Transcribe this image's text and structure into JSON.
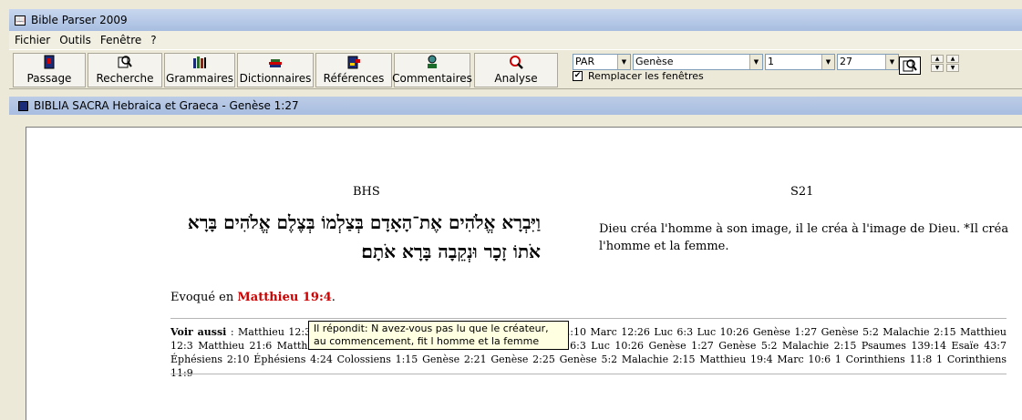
{
  "window": {
    "title": "Bible Parser 2009"
  },
  "menu": [
    "Fichier",
    "Outils",
    "Fenêtre",
    "?"
  ],
  "toolbar": {
    "buttons": [
      {
        "label": "Passage",
        "icon": "bible-book-icon"
      },
      {
        "label": "Recherche",
        "icon": "search-magnifier-icon"
      },
      {
        "label": "Grammaires",
        "icon": "grammar-books-icon"
      },
      {
        "label": "Dictionnaires",
        "icon": "dictionary-books-icon"
      },
      {
        "label": "Références",
        "icon": "references-book-icon"
      },
      {
        "label": "Commentaires",
        "icon": "commentary-person-icon"
      },
      {
        "label": "Analyse",
        "icon": "analysis-magnifier-icon"
      }
    ],
    "version_select": "PAR",
    "book_select": "Genèse",
    "chapter_select": "1",
    "verse_select": "27",
    "replace_windows_label": "Remplacer les fenêtres",
    "replace_windows_checked": true
  },
  "document": {
    "title": "BIBLIA SACRA Hebraica et Graeca - Genèse 1:27",
    "bhs_header": "BHS",
    "s21_header": "S21",
    "hebrew_text": "וַיִּבְרָא אֱלֹהִים אֶת־הָאָדָם בְּצַלְמוֹ בְּצֶלֶם אֱלֹהִים בָּרָא אֹתוֹ זָכָר וּנְקֵבָה בָּרָא אֹתָם׃",
    "french_text": "Dieu créa l'homme à son image, il le créa à l'image de Dieu. *Il créa l'homme et la femme.",
    "evoque_prefix": "Evoqué en ",
    "evoque_ref": "Matthieu 19:4",
    "evoque_suffix": ".",
    "voir_aussi_label": "Voir aussi",
    "voir_aussi_text": " : Matthieu 12:3 Matthieu 21:6 Matthieu 19:4 Marc 10:6 Marc 12:10 Marc 12:26 Luc 6:3 Luc 10:26 Genèse 1:27 Genèse 5:2 Malachie 2:15 Matthieu 12:3 Matthieu 21:6 Matthieu 19:4 Marc 10:6 Marc 12:10 Marc 12:26 Luc 6:3 Luc 10:26 Genèse 1:27 Genèse 5:2 Malachie 2:15 Psaumes 139:14 Esaïe 43:7 Éphésiens 2:10 Éphésiens 4:24 Colossiens 1:15 Genèse 2:21 Genèse 2:25 Genèse 5:2 Malachie 2:15 Matthieu 19:4 Marc 10:6 1 Corinthiens 11:8 1 Corinthiens 11:9",
    "tooltip": "Il répondit: N avez-vous pas lu que le créateur, au commencement, fit l homme et la femme"
  },
  "colors": {
    "reference_red": "#cc0000",
    "tooltip_bg": "#ffffe1",
    "titlebar": "#b4c8e8"
  }
}
